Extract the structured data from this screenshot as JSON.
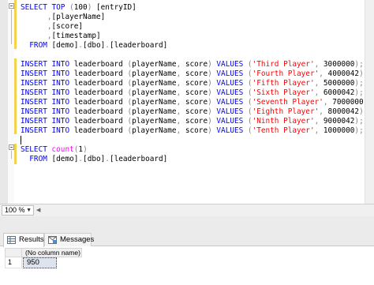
{
  "editor": {
    "lines": [
      [
        [
          "kw",
          "SELECT TOP "
        ],
        [
          "gry",
          "("
        ],
        [
          "",
          "100"
        ],
        [
          "gry",
          ")"
        ],
        [
          "",
          " [entryID]"
        ]
      ],
      [
        [
          "gry",
          "      ,"
        ],
        [
          "",
          "[playerName]"
        ]
      ],
      [
        [
          "gry",
          "      ,"
        ],
        [
          "",
          "[score]"
        ]
      ],
      [
        [
          "gry",
          "      ,"
        ],
        [
          "",
          "[timestamp]"
        ]
      ],
      [
        [
          "kw",
          "  FROM "
        ],
        [
          "",
          "[demo]"
        ],
        [
          "gry",
          "."
        ],
        [
          "",
          "[dbo]"
        ],
        [
          "gry",
          "."
        ],
        [
          "",
          "[leaderboard]"
        ]
      ],
      [
        [
          "",
          ""
        ]
      ],
      [
        [
          "kw",
          "INSERT INTO"
        ],
        [
          "",
          " leaderboard "
        ],
        [
          "gry",
          "("
        ],
        [
          "",
          "playerName"
        ],
        [
          "gry",
          ","
        ],
        [
          "",
          " score"
        ],
        [
          "gry",
          ")"
        ],
        [
          "kw",
          " VALUES "
        ],
        [
          "gry",
          "("
        ],
        [
          "str",
          "'Third Player'"
        ],
        [
          "gry",
          ","
        ],
        [
          "",
          " 3000000"
        ],
        [
          "gry",
          ");"
        ]
      ],
      [
        [
          "kw",
          "INSERT INTO"
        ],
        [
          "",
          " leaderboard "
        ],
        [
          "gry",
          "("
        ],
        [
          "",
          "playerName"
        ],
        [
          "gry",
          ","
        ],
        [
          "",
          " score"
        ],
        [
          "gry",
          ")"
        ],
        [
          "kw",
          " VALUES "
        ],
        [
          "gry",
          "("
        ],
        [
          "str",
          "'Fourth Player'"
        ],
        [
          "gry",
          ","
        ],
        [
          "",
          " 4000042"
        ],
        [
          "gry",
          ");"
        ]
      ],
      [
        [
          "kw",
          "INSERT INTO"
        ],
        [
          "",
          " leaderboard "
        ],
        [
          "gry",
          "("
        ],
        [
          "",
          "playerName"
        ],
        [
          "gry",
          ","
        ],
        [
          "",
          " score"
        ],
        [
          "gry",
          ")"
        ],
        [
          "kw",
          " VALUES "
        ],
        [
          "gry",
          "("
        ],
        [
          "str",
          "'Fifth Player'"
        ],
        [
          "gry",
          ","
        ],
        [
          "",
          " 5000000"
        ],
        [
          "gry",
          ");"
        ]
      ],
      [
        [
          "kw",
          "INSERT INTO"
        ],
        [
          "",
          " leaderboard "
        ],
        [
          "gry",
          "("
        ],
        [
          "",
          "playerName"
        ],
        [
          "gry",
          ","
        ],
        [
          "",
          " score"
        ],
        [
          "gry",
          ")"
        ],
        [
          "kw",
          " VALUES "
        ],
        [
          "gry",
          "("
        ],
        [
          "str",
          "'Sixth Player'"
        ],
        [
          "gry",
          ","
        ],
        [
          "",
          " 6000042"
        ],
        [
          "gry",
          ");"
        ]
      ],
      [
        [
          "kw",
          "INSERT INTO"
        ],
        [
          "",
          " leaderboard "
        ],
        [
          "gry",
          "("
        ],
        [
          "",
          "playerName"
        ],
        [
          "gry",
          ","
        ],
        [
          "",
          " score"
        ],
        [
          "gry",
          ")"
        ],
        [
          "kw",
          " VALUES "
        ],
        [
          "gry",
          "("
        ],
        [
          "str",
          "'Seventh Player'"
        ],
        [
          "gry",
          ","
        ],
        [
          "",
          " 7000000"
        ],
        [
          "gry",
          ");"
        ]
      ],
      [
        [
          "kw",
          "INSERT INTO"
        ],
        [
          "",
          " leaderboard "
        ],
        [
          "gry",
          "("
        ],
        [
          "",
          "playerName"
        ],
        [
          "gry",
          ","
        ],
        [
          "",
          " score"
        ],
        [
          "gry",
          ")"
        ],
        [
          "kw",
          " VALUES "
        ],
        [
          "gry",
          "("
        ],
        [
          "str",
          "'Eighth Player'"
        ],
        [
          "gry",
          ","
        ],
        [
          "",
          " 8000042"
        ],
        [
          "gry",
          ");"
        ]
      ],
      [
        [
          "kw",
          "INSERT INTO"
        ],
        [
          "",
          " leaderboard "
        ],
        [
          "gry",
          "("
        ],
        [
          "",
          "playerName"
        ],
        [
          "gry",
          ","
        ],
        [
          "",
          " score"
        ],
        [
          "gry",
          ")"
        ],
        [
          "kw",
          " VALUES "
        ],
        [
          "gry",
          "("
        ],
        [
          "str",
          "'Ninth Player'"
        ],
        [
          "gry",
          ","
        ],
        [
          "",
          " 9000042"
        ],
        [
          "gry",
          ");"
        ]
      ],
      [
        [
          "kw",
          "INSERT INTO"
        ],
        [
          "",
          " leaderboard "
        ],
        [
          "gry",
          "("
        ],
        [
          "",
          "playerName"
        ],
        [
          "gry",
          ","
        ],
        [
          "",
          " score"
        ],
        [
          "gry",
          ")"
        ],
        [
          "kw",
          " VALUES "
        ],
        [
          "gry",
          "("
        ],
        [
          "str",
          "'Tenth Player'"
        ],
        [
          "gry",
          ","
        ],
        [
          "",
          " 1000000"
        ],
        [
          "gry",
          ");"
        ]
      ],
      [
        [
          "",
          ""
        ]
      ],
      [
        [
          "kw",
          "SELECT "
        ],
        [
          "fn",
          "count"
        ],
        [
          "gry",
          "("
        ],
        [
          "",
          "1"
        ],
        [
          "gry",
          ")"
        ]
      ],
      [
        [
          "kw",
          "  FROM "
        ],
        [
          "",
          "[demo]"
        ],
        [
          "gry",
          "."
        ],
        [
          "",
          "[dbo]"
        ],
        [
          "gry",
          "."
        ],
        [
          "",
          "[leaderboard]"
        ]
      ]
    ]
  },
  "zoom": {
    "value": "100 %"
  },
  "results": {
    "tabs": [
      {
        "label": "Results",
        "icon": "grid-icon"
      },
      {
        "label": "Messages",
        "icon": "messages-icon"
      }
    ],
    "column_header": "(No column name)",
    "row_number": "1",
    "cell_value": "950"
  }
}
